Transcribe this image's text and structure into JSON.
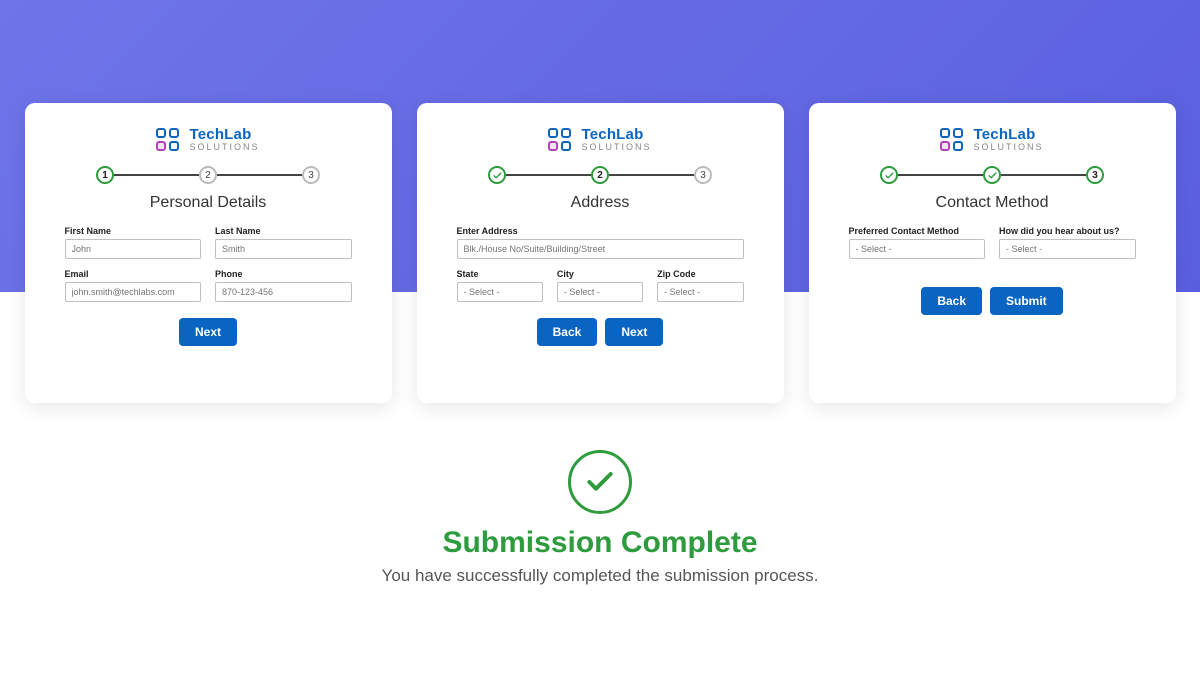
{
  "brand": {
    "name": "TechLab",
    "sub": "SOLUTIONS"
  },
  "steps": {
    "s1": "1",
    "s2": "2",
    "s3": "3"
  },
  "card1": {
    "title": "Personal Details",
    "first_name_label": "First Name",
    "first_name_ph": "John",
    "last_name_label": "Last Name",
    "last_name_ph": "Smith",
    "email_label": "Email",
    "email_ph": "john.smith@techlabs.com",
    "phone_label": "Phone",
    "phone_ph": "870-123-456",
    "next": "Next"
  },
  "card2": {
    "title": "Address",
    "address_label": "Enter Address",
    "address_ph": "Blk./House No/Suite/Building/Street",
    "state_label": "State",
    "city_label": "City",
    "zip_label": "Zip Code",
    "select_ph": "- Select -",
    "back": "Back",
    "next": "Next"
  },
  "card3": {
    "title": "Contact Method",
    "pref_label": "Preferred Contact Method",
    "hear_label": "How did you hear about us?",
    "select_ph": "- Select -",
    "back": "Back",
    "submit": "Submit"
  },
  "done": {
    "title": "Submission Complete",
    "msg": "You have successfully completed the submission process."
  }
}
